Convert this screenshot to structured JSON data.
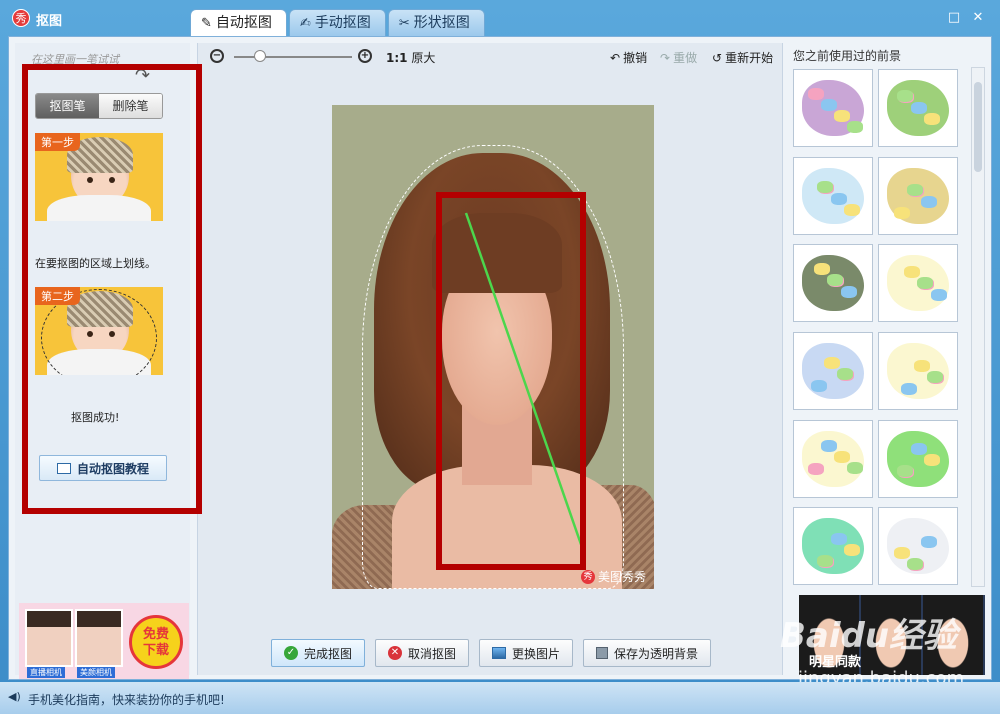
{
  "app": {
    "title": "抠图",
    "logo": "秀"
  },
  "tabs": [
    {
      "label": "自动抠图",
      "icon": "brush-icon",
      "active": true
    },
    {
      "label": "手动抠图",
      "icon": "hand-brush-icon",
      "active": false
    },
    {
      "label": "形状抠图",
      "icon": "shape-icon",
      "active": false
    }
  ],
  "window_buttons": {
    "maximize": "□",
    "close": "✕"
  },
  "left_panel": {
    "scribble_hint": "在这里画一笔试试",
    "segmented": {
      "brush_label": "抠图笔",
      "eraser_label": "删除笔"
    },
    "step1": {
      "badge": "第一步",
      "caption": "在要抠图的区域上划线。"
    },
    "step2": {
      "badge": "第二步",
      "caption": "抠图成功!"
    },
    "tutorial_button": "自动抠图教程",
    "ad": {
      "badge_line1": "免费",
      "badge_line2": "下载",
      "cap1": "直播相机",
      "cap2": "美颜相机"
    }
  },
  "toolbar": {
    "original_ratio": "1:1",
    "original_label": "原大",
    "undo": "撤销",
    "redo": "重做",
    "restart": "重新开始",
    "zoom_level": 0.2
  },
  "canvas": {
    "watermark": "美图秀秀",
    "watermark_logo": "秀"
  },
  "bottom_buttons": {
    "finish": "完成抠图",
    "cancel": "取消抠图",
    "replace": "更换图片",
    "save_transparent": "保存为透明背景"
  },
  "right_panel": {
    "title": "您之前使用过的前景",
    "thumbnails": [
      {
        "name": "map-china-1",
        "color": "#c9a6d6"
      },
      {
        "name": "map-china-2",
        "color": "#9ed07a"
      },
      {
        "name": "map-province-1",
        "color": "#cfe8f6"
      },
      {
        "name": "map-province-2",
        "color": "#e7d58f"
      },
      {
        "name": "map-province-3",
        "color": "#7a8a6a"
      },
      {
        "name": "map-province-4",
        "color": "#fbf7d0"
      },
      {
        "name": "map-province-5",
        "color": "#c8d9f3"
      },
      {
        "name": "map-province-6",
        "color": "#fbf7d0"
      },
      {
        "name": "map-province-7",
        "color": "#fbf7d0"
      },
      {
        "name": "map-province-8",
        "color": "#8fe07a"
      },
      {
        "name": "map-province-9",
        "color": "#7fe0b6"
      },
      {
        "name": "map-province-10",
        "color": "#eef0f4"
      }
    ],
    "ad_caption": "明星同款"
  },
  "watermark": {
    "brand": "Baidu经验",
    "url": "jingyan.baidu.com"
  },
  "status": {
    "text": "手机美化指南，快来装扮你的手机吧!"
  },
  "colors": {
    "annotation_red": "#b40000",
    "accent_blue": "#3c8cc8",
    "guide_green": "#4cd64c"
  }
}
